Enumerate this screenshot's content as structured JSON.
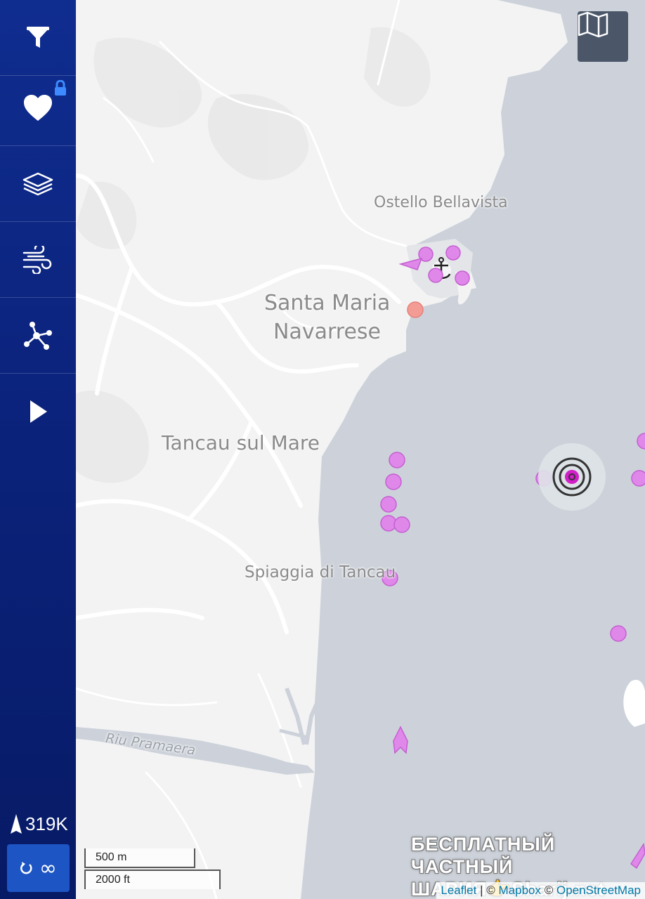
{
  "sidebar": {
    "items": [
      {
        "name": "filter",
        "icon": "filter-icon"
      },
      {
        "name": "favorites",
        "icon": "heart-icon",
        "badge_icon": "lock-icon"
      },
      {
        "name": "layers",
        "icon": "layers-icon"
      },
      {
        "name": "weather",
        "icon": "wind-icon"
      },
      {
        "name": "network",
        "icon": "network-icon"
      },
      {
        "name": "playback",
        "icon": "play-icon"
      }
    ],
    "vessel_count": "319K",
    "vessel_icon": "ship-icon",
    "refresh_icon": "refresh-icon",
    "refresh_value": "∞"
  },
  "map": {
    "places": {
      "ostello": "Ostello Bellavista",
      "santa_maria_line1": "Santa Maria",
      "santa_maria_line2": "Navarrese",
      "tancau": "Tancau sul Mare",
      "spiaggia": "Spiaggia di Tancau",
      "river": "Riu Pramaera"
    },
    "map_toggle_icon": "map-icon",
    "scale_metric": "500 m",
    "scale_imperial": "2000 ft",
    "attribution": {
      "leaflet": "Leaflet",
      "separator": "| ©",
      "mapbox": "Mapbox",
      "separator2": "©",
      "osm": "OpenStreetMap"
    },
    "watermark_line1": "БЕСПЛАТНЫЙ ЧАСТНЫЙ",
    "watermark_line2": "ШАРИЯ👉Sharij.net",
    "colors": {
      "sea": "#cdd2da",
      "land": "#f3f3f4",
      "vessel": "#e087ea",
      "vessel_stroke": "#c45fd1",
      "selected": "#d21fc8",
      "red_vessel": "#f39c96"
    }
  }
}
